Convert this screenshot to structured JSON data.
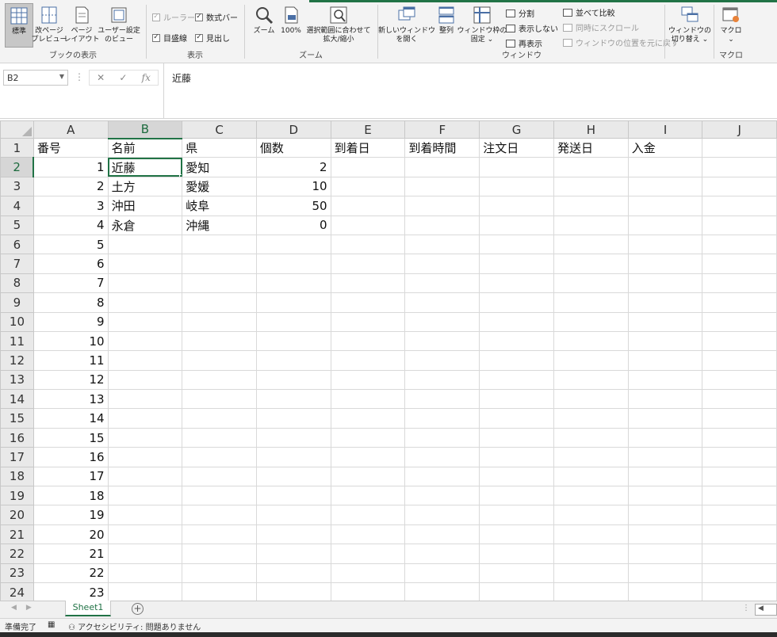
{
  "ribbon": {
    "groups": {
      "workbook_views": {
        "label": "ブックの表示",
        "normal": "標準",
        "page_break_1": "改ページ",
        "page_break_2": "プレビュー",
        "page_layout_1": "ページ",
        "page_layout_2": "レイアウト",
        "custom_views_1": "ユーザー設定",
        "custom_views_2": "のビュー"
      },
      "show": {
        "label": "表示",
        "ruler": "ルーラー",
        "formula_bar": "数式バー",
        "gridlines": "目盛線",
        "headings": "見出し"
      },
      "zoom": {
        "label": "ズーム",
        "zoom": "ズーム",
        "hundred": "100%",
        "zoom_selection_1": "選択範囲に合わせて",
        "zoom_selection_2": "拡大/縮小"
      },
      "window": {
        "label": "ウィンドウ",
        "new_window_1": "新しいウィンドウ",
        "new_window_2": "を開く",
        "arrange": "整列",
        "freeze_1": "ウィンドウ枠の",
        "freeze_2": "固定 ⌄",
        "split": "分割",
        "hide": "表示しない",
        "unhide": "再表示",
        "side_by_side": "並べて比較",
        "sync_scroll": "同時にスクロール",
        "reset_position": "ウィンドウの位置を元に戻す",
        "switch_1": "ウィンドウの",
        "switch_2": "切り替え ⌄"
      },
      "macros": {
        "label": "マクロ",
        "macros_1": "マクロ",
        "macros_2": "⌄"
      }
    }
  },
  "formula_bar": {
    "name_box": "B2",
    "fx": "fx",
    "content": "近藤"
  },
  "sheet": {
    "columns": [
      "A",
      "B",
      "C",
      "D",
      "E",
      "F",
      "G",
      "H",
      "I",
      "J"
    ],
    "selected_column": "B",
    "selected_row": 2,
    "rows": [
      {
        "n": "1",
        "cells": [
          "番号",
          "名前",
          "県",
          "個数",
          "到着日",
          "到着時間",
          "注文日",
          "発送日",
          "入金",
          ""
        ]
      },
      {
        "n": "2",
        "cells": [
          "1",
          "近藤",
          "愛知",
          "2",
          "",
          "",
          "",
          "",
          "",
          ""
        ]
      },
      {
        "n": "3",
        "cells": [
          "2",
          "土方",
          "愛媛",
          "10",
          "",
          "",
          "",
          "",
          "",
          ""
        ]
      },
      {
        "n": "4",
        "cells": [
          "3",
          "沖田",
          "岐阜",
          "50",
          "",
          "",
          "",
          "",
          "",
          ""
        ]
      },
      {
        "n": "5",
        "cells": [
          "4",
          "永倉",
          "沖縄",
          "0",
          "",
          "",
          "",
          "",
          "",
          ""
        ]
      },
      {
        "n": "6",
        "cells": [
          "5",
          "",
          "",
          "",
          "",
          "",
          "",
          "",
          "",
          ""
        ]
      },
      {
        "n": "7",
        "cells": [
          "6",
          "",
          "",
          "",
          "",
          "",
          "",
          "",
          "",
          ""
        ]
      },
      {
        "n": "8",
        "cells": [
          "7",
          "",
          "",
          "",
          "",
          "",
          "",
          "",
          "",
          ""
        ]
      },
      {
        "n": "9",
        "cells": [
          "8",
          "",
          "",
          "",
          "",
          "",
          "",
          "",
          "",
          ""
        ]
      },
      {
        "n": "10",
        "cells": [
          "9",
          "",
          "",
          "",
          "",
          "",
          "",
          "",
          "",
          ""
        ]
      },
      {
        "n": "11",
        "cells": [
          "10",
          "",
          "",
          "",
          "",
          "",
          "",
          "",
          "",
          ""
        ]
      },
      {
        "n": "12",
        "cells": [
          "11",
          "",
          "",
          "",
          "",
          "",
          "",
          "",
          "",
          ""
        ]
      },
      {
        "n": "13",
        "cells": [
          "12",
          "",
          "",
          "",
          "",
          "",
          "",
          "",
          "",
          ""
        ]
      },
      {
        "n": "14",
        "cells": [
          "13",
          "",
          "",
          "",
          "",
          "",
          "",
          "",
          "",
          ""
        ]
      },
      {
        "n": "15",
        "cells": [
          "14",
          "",
          "",
          "",
          "",
          "",
          "",
          "",
          "",
          ""
        ]
      },
      {
        "n": "16",
        "cells": [
          "15",
          "",
          "",
          "",
          "",
          "",
          "",
          "",
          "",
          ""
        ]
      },
      {
        "n": "17",
        "cells": [
          "16",
          "",
          "",
          "",
          "",
          "",
          "",
          "",
          "",
          ""
        ]
      },
      {
        "n": "18",
        "cells": [
          "17",
          "",
          "",
          "",
          "",
          "",
          "",
          "",
          "",
          ""
        ]
      },
      {
        "n": "19",
        "cells": [
          "18",
          "",
          "",
          "",
          "",
          "",
          "",
          "",
          "",
          ""
        ]
      },
      {
        "n": "20",
        "cells": [
          "19",
          "",
          "",
          "",
          "",
          "",
          "",
          "",
          "",
          ""
        ]
      },
      {
        "n": "21",
        "cells": [
          "20",
          "",
          "",
          "",
          "",
          "",
          "",
          "",
          "",
          ""
        ]
      },
      {
        "n": "22",
        "cells": [
          "21",
          "",
          "",
          "",
          "",
          "",
          "",
          "",
          "",
          ""
        ]
      },
      {
        "n": "23",
        "cells": [
          "22",
          "",
          "",
          "",
          "",
          "",
          "",
          "",
          "",
          ""
        ]
      },
      {
        "n": "24",
        "cells": [
          "23",
          "",
          "",
          "",
          "",
          "",
          "",
          "",
          "",
          ""
        ]
      }
    ]
  },
  "tabs": {
    "sheet1": "Sheet1",
    "add": "+"
  },
  "status": {
    "ready": "準備完了",
    "accessibility": "アクセシビリティ: 問題ありません"
  },
  "colors": {
    "accent": "#217346",
    "header_bg": "#e9e9e9",
    "ribbon_bg": "#f3f3f3"
  },
  "icons": [
    "normal-view-icon",
    "page-break-icon",
    "page-layout-icon",
    "custom-views-icon",
    "zoom-icon",
    "zoom-100-icon",
    "zoom-selection-icon",
    "new-window-icon",
    "arrange-icon",
    "freeze-panes-icon",
    "split-icon",
    "switch-window-icon",
    "macros-icon",
    "add-sheet-icon"
  ]
}
